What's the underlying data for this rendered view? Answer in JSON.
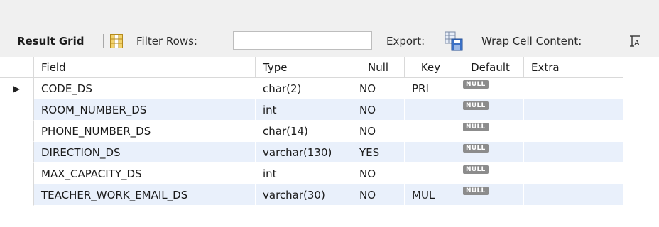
{
  "toolbar": {
    "result_grid_label": "Result Grid",
    "filter_rows_label": "Filter Rows:",
    "filter_value": "",
    "export_label": "Export:",
    "wrap_label": "Wrap Cell Content:",
    "wrap_icon_glyph": "̲IA"
  },
  "table": {
    "columns": [
      "Field",
      "Type",
      "Null",
      "Key",
      "Default",
      "Extra"
    ],
    "rows": [
      {
        "field": "CODE_DS",
        "type": "char(2)",
        "null": "NO",
        "key": "PRI",
        "default": "NULL",
        "extra": ""
      },
      {
        "field": "ROOM_NUMBER_DS",
        "type": "int",
        "null": "NO",
        "key": "",
        "default": "NULL",
        "extra": ""
      },
      {
        "field": "PHONE_NUMBER_DS",
        "type": "char(14)",
        "null": "NO",
        "key": "",
        "default": "NULL",
        "extra": ""
      },
      {
        "field": "DIRECTION_DS",
        "type": "varchar(130)",
        "null": "YES",
        "key": "",
        "default": "NULL",
        "extra": ""
      },
      {
        "field": "MAX_CAPACITY_DS",
        "type": "int",
        "null": "NO",
        "key": "",
        "default": "NULL",
        "extra": ""
      },
      {
        "field": "TEACHER_WORK_EMAIL_DS",
        "type": "varchar(30)",
        "null": "NO",
        "key": "MUL",
        "default": "NULL",
        "extra": ""
      }
    ],
    "selected_row_marker": "▶"
  },
  "colors": {
    "toolbar_bg": "#f0f0f0",
    "row_alt_bg": "#e9f0fb",
    "null_badge_bg": "#8c8c8c"
  }
}
